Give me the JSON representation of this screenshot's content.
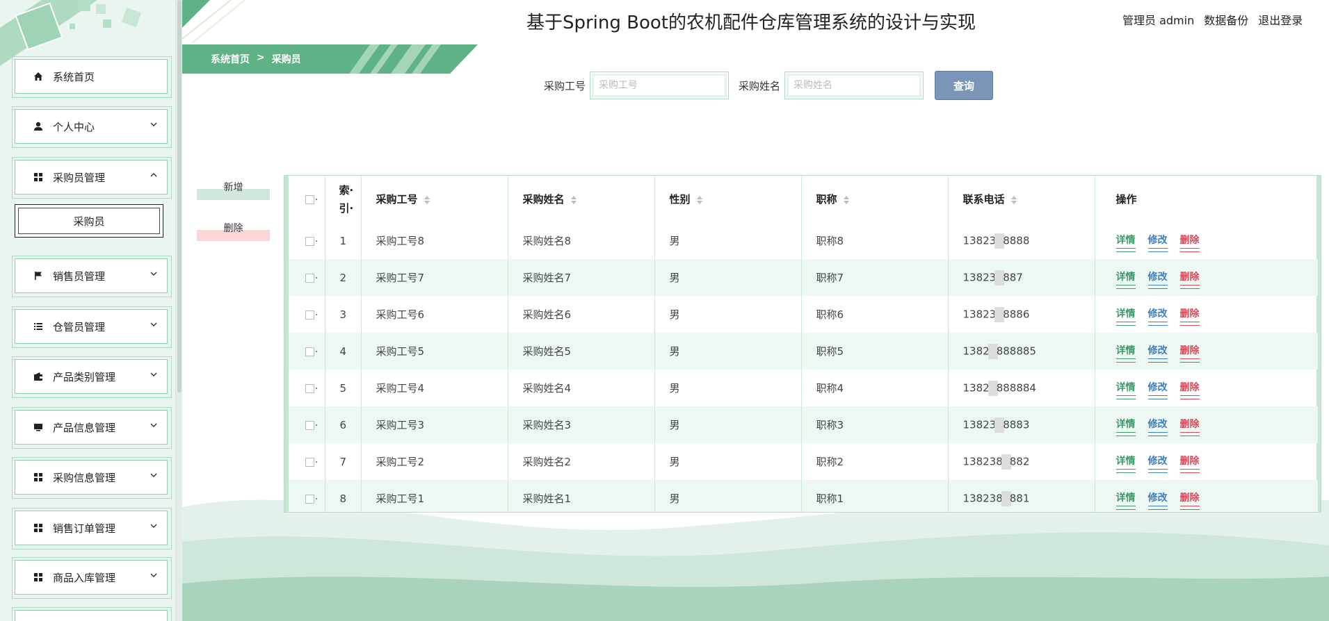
{
  "app": {
    "title": "基于Spring Boot的农机配件仓库管理系统的设计与实现",
    "user_label": "管理员 admin",
    "backup_label": "数据备份",
    "logout_label": "退出登录"
  },
  "colors": {
    "brand_green": "#5fb186",
    "query_button": "#7b95b8",
    "detail_link": "#3a9a6a",
    "edit_link": "#3a7fc1",
    "delete_link": "#d44a5a"
  },
  "sidebar": {
    "items": [
      {
        "label": "系统首页",
        "icon": "home-icon"
      },
      {
        "label": "个人中心",
        "icon": "person-icon"
      },
      {
        "label": "采购员管理",
        "icon": "grid-icon"
      },
      {
        "label": "销售员管理",
        "icon": "flag-icon"
      },
      {
        "label": "仓管员管理",
        "icon": "list-icon"
      },
      {
        "label": "产品类别管理",
        "icon": "wallet-icon"
      },
      {
        "label": "产品信息管理",
        "icon": "monitor-icon"
      },
      {
        "label": "采购信息管理",
        "icon": "grid-icon"
      },
      {
        "label": "销售订单管理",
        "icon": "grid-icon"
      },
      {
        "label": "商品入库管理",
        "icon": "grid-icon"
      }
    ],
    "submenu": {
      "label": "采购员"
    }
  },
  "breadcrumb": {
    "home": "系统首页",
    "separator": ">",
    "current": "采购员"
  },
  "search": {
    "field1_label": "采购工号",
    "field1_placeholder": "采购工号",
    "field2_label": "采购姓名",
    "field2_placeholder": "采购姓名",
    "button_label": "查询"
  },
  "actions": {
    "add_label": "新增",
    "delete_label": "删除"
  },
  "table": {
    "headers": {
      "index_line1": "索·",
      "index_line2": "引·",
      "worker_id": "采购工号",
      "name": "采购姓名",
      "gender": "性别",
      "title": "职称",
      "phone": "联系电话",
      "ops": "操作"
    },
    "op_labels": {
      "detail": "详情",
      "edit": "修改",
      "delete": "删除"
    },
    "rows": [
      {
        "index": "1",
        "worker_id": "采购工号8",
        "name": "采购姓名8",
        "gender": "男",
        "title": "职称8",
        "phone_a": "13823",
        "phone_b": "8888"
      },
      {
        "index": "2",
        "worker_id": "采购工号7",
        "name": "采购姓名7",
        "gender": "男",
        "title": "职称7",
        "phone_a": "13823",
        "phone_b": "887"
      },
      {
        "index": "3",
        "worker_id": "采购工号6",
        "name": "采购姓名6",
        "gender": "男",
        "title": "职称6",
        "phone_a": "13823",
        "phone_b": "8886"
      },
      {
        "index": "4",
        "worker_id": "采购工号5",
        "name": "采购姓名5",
        "gender": "男",
        "title": "职称5",
        "phone_a": "1382",
        "phone_b": "888885"
      },
      {
        "index": "5",
        "worker_id": "采购工号4",
        "name": "采购姓名4",
        "gender": "男",
        "title": "职称4",
        "phone_a": "1382",
        "phone_b": "888884"
      },
      {
        "index": "6",
        "worker_id": "采购工号3",
        "name": "采购姓名3",
        "gender": "男",
        "title": "职称3",
        "phone_a": "13823",
        "phone_b": "8883"
      },
      {
        "index": "7",
        "worker_id": "采购工号2",
        "name": "采购姓名2",
        "gender": "男",
        "title": "职称2",
        "phone_a": "138238",
        "phone_b": "882"
      },
      {
        "index": "8",
        "worker_id": "采购工号1",
        "name": "采购姓名1",
        "gender": "男",
        "title": "职称1",
        "phone_a": "138238",
        "phone_b": "881"
      }
    ]
  }
}
